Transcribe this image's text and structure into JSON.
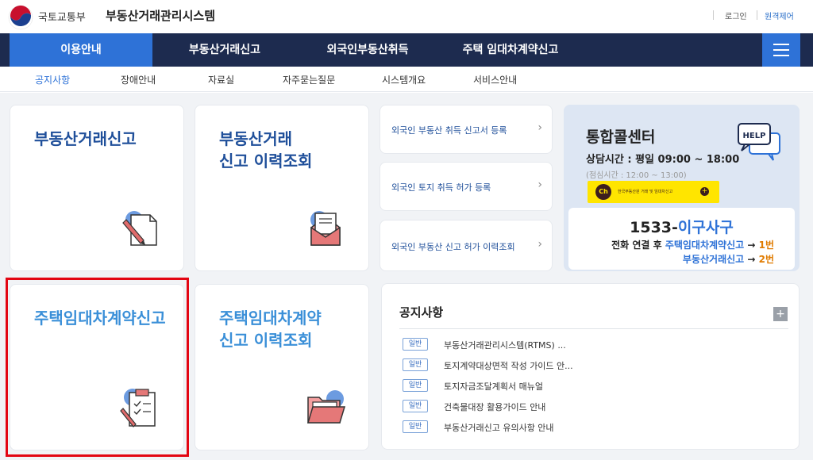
{
  "header": {
    "ministry": "국토교통부",
    "system_title": "부동산거래관리시스템",
    "login": "로그인",
    "remote": "원격제어"
  },
  "mainnav": {
    "items": [
      "이용안내",
      "부동산거래신고",
      "외국인부동산취득",
      "주택 임대차계약신고"
    ]
  },
  "subnav": {
    "items": [
      "공지사항",
      "장애안내",
      "자료실",
      "자주묻는질문",
      "시스템개요",
      "서비스안내"
    ]
  },
  "cards": {
    "report": "부동산거래신고",
    "report_history": "부동산거래\n신고 이력조회",
    "lease": "주택임대차계약신고",
    "lease_history": "주택임대차계약\n신고 이력조회"
  },
  "links": [
    "외국인 부동산 취득 신고서 등록",
    "외국인 토지 취득 허가 등록",
    "외국인 부동산 신고 허가 이력조회"
  ],
  "callcenter": {
    "title": "통합콜센터",
    "hours": "상담시간 : 평일 09:00 ~ 18:00",
    "lunch": "(점심시간 : 12:00 ~ 13:00)",
    "kakao_label": "Ch",
    "kakao_text": "한국부동산원 거래 및 임대차신고",
    "help": "HELP",
    "phone_prefix": "1533-",
    "phone_word": "이구사구",
    "line1_prefix": "전화 연결 후 ",
    "line1_highlight": "주택임대차계약신고",
    "line1_arrow": " → ",
    "line1_num": "1번",
    "line2_highlight": "부동산거래신고",
    "line2_arrow": " → ",
    "line2_num": "2번"
  },
  "notice": {
    "title": "공지사항",
    "plus": "+",
    "badge": "일반",
    "items": [
      "부동산거래관리시스템(RTMS) ...",
      "토지계약대상면적 작성 가이드 안...",
      "토지자금조달계획서 매뉴얼",
      "건축물대장 활용가이드 안내",
      "부동산거래신고 유의사항 안내"
    ]
  },
  "colors": {
    "nav_bg": "#1d2b4f",
    "accent": "#2e72d7",
    "highlight": "#e30613"
  }
}
